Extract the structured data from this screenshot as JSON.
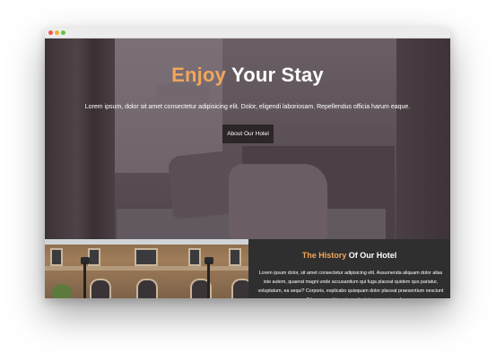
{
  "hero": {
    "title_accent": "Enjoy",
    "title_rest": "Your Stay",
    "text": "Lorem ipsum, dolor sit amet consectetur adipisicing elit. Dolor, eligendi laboriosam. Repellendus officia harum eaque.",
    "button_label": "About Our Hotel"
  },
  "history": {
    "title_accent": "The History",
    "title_rest": "Of Our Hotel",
    "text": "Lorem ipsum dolor, sit amet consectetur adipisicing elit. Assumenda aliquam dolor alias iste autem, quaerat magni unde accusantium qui fuga placeat quidem quo pariatur, voluptatum, ea sequi? Corporis, explicabo quisquam dolor placeat praesentium nesciunt mollitia quos nobis natus voluptatum asperiores!"
  },
  "colors": {
    "accent": "#f2a65a",
    "dark_section": "#2f2f2f",
    "button_bg": "#2c2629"
  }
}
